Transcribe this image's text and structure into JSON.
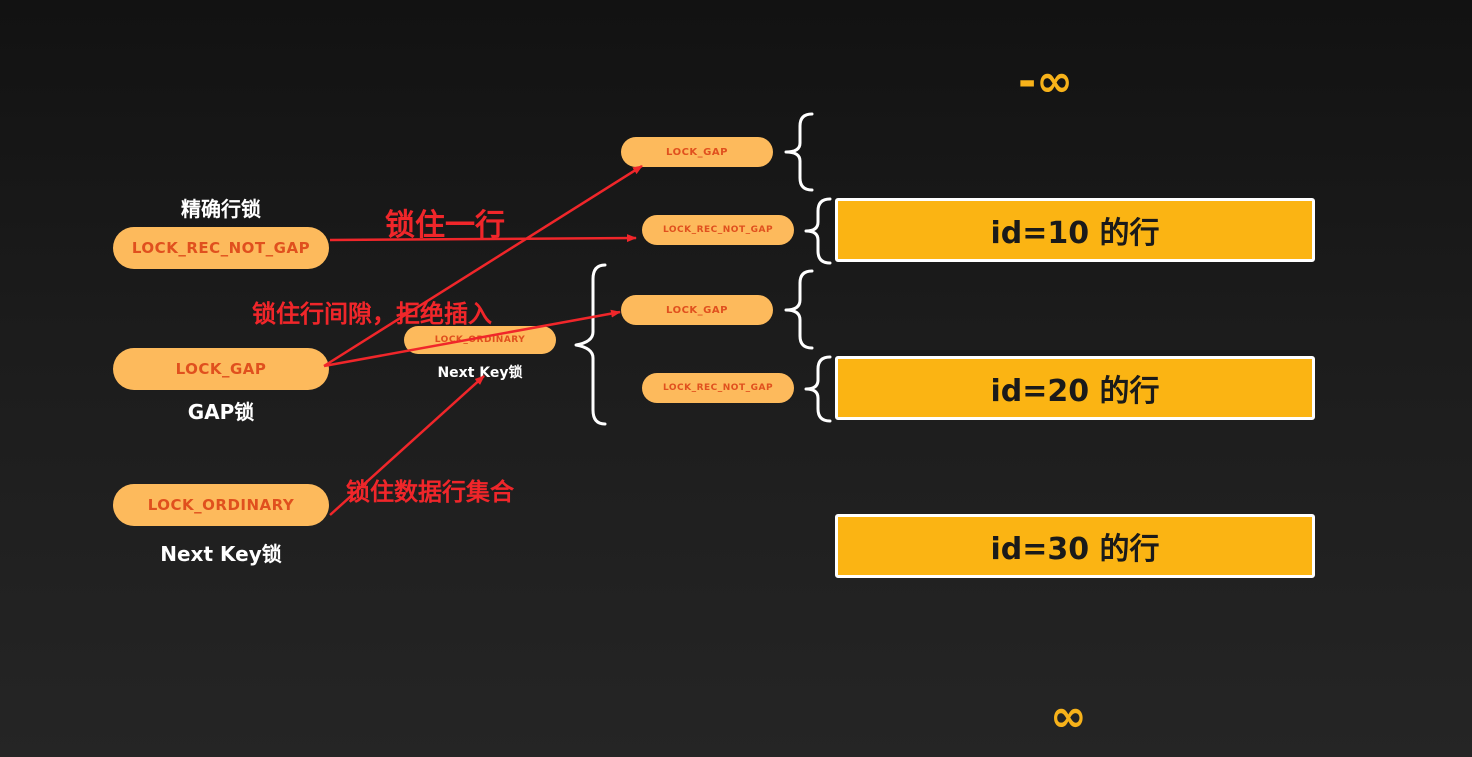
{
  "legend": {
    "exact_row_lock": {
      "caption": "精确行锁",
      "pill": "LOCK_REC_NOT_GAP"
    },
    "gap_lock": {
      "caption": "GAP锁",
      "pill": "LOCK_GAP"
    },
    "next_key_lock": {
      "caption": "Next Key锁",
      "pill": "LOCK_ORDINARY"
    }
  },
  "annotations": {
    "lock_one_row": "锁住一行",
    "lock_gap_reject_insert": "锁住行间隙，拒绝插入",
    "lock_row_set": "锁住数据行集合"
  },
  "middle": {
    "lock_gap_1": "LOCK_GAP",
    "lock_rec_not_gap_1": "LOCK_REC_NOT_GAP",
    "lock_gap_2": "LOCK_GAP",
    "lock_rec_not_gap_2": "LOCK_REC_NOT_GAP",
    "lock_ordinary": "LOCK_ORDINARY",
    "next_key_caption": "Next Key锁"
  },
  "rows": [
    "id=10 的行",
    "id=20 的行",
    "id=30 的行"
  ],
  "infinity": {
    "negative": "-∞",
    "positive": "∞"
  },
  "colors": {
    "pill": "#fdba5c",
    "pill_text": "#e0501e",
    "row_fill": "#fbb413",
    "arrow": "#f0262a",
    "infinity": "#f7b21a"
  }
}
